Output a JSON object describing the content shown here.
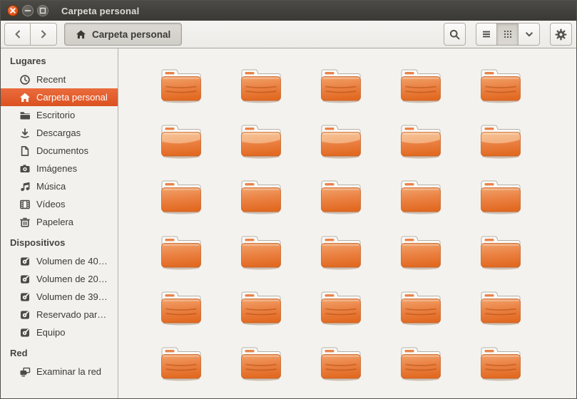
{
  "window": {
    "title": "Carpeta personal",
    "controls": [
      {
        "icon": "close"
      },
      {
        "icon": "minimize"
      },
      {
        "icon": "maximize"
      }
    ]
  },
  "toolbar": {
    "back_icon": "chevron-left",
    "forward_icon": "chevron-right",
    "path_button": {
      "icon": "home",
      "label": "Carpeta personal"
    },
    "search_icon": "search",
    "view_switcher": {
      "options": [
        {
          "name": "list",
          "icon": "list"
        },
        {
          "name": "grid",
          "icon": "grid"
        },
        {
          "name": "options",
          "icon": "chevron-down"
        }
      ],
      "active": "grid"
    },
    "settings_icon": "gear"
  },
  "sidebar": {
    "sections": [
      {
        "title": "Lugares",
        "items": [
          {
            "label": "Recent",
            "icon": "clock",
            "selected": false
          },
          {
            "label": "Carpeta personal",
            "icon": "home",
            "selected": true
          },
          {
            "label": "Escritorio",
            "icon": "desktop-folder",
            "selected": false
          },
          {
            "label": "Descargas",
            "icon": "download",
            "selected": false
          },
          {
            "label": "Documentos",
            "icon": "document",
            "selected": false
          },
          {
            "label": "Imágenes",
            "icon": "camera",
            "selected": false
          },
          {
            "label": "Música",
            "icon": "music",
            "selected": false
          },
          {
            "label": "Vídeos",
            "icon": "film",
            "selected": false
          },
          {
            "label": "Papelera",
            "icon": "trash",
            "selected": false
          }
        ]
      },
      {
        "title": "Dispositivos",
        "items": [
          {
            "label": "Volumen de 40…",
            "icon": "drive",
            "selected": false
          },
          {
            "label": "Volumen de 20…",
            "icon": "drive",
            "selected": false
          },
          {
            "label": "Volumen de 39…",
            "icon": "drive",
            "selected": false
          },
          {
            "label": "Reservado par…",
            "icon": "drive",
            "selected": false
          },
          {
            "label": "Equipo",
            "icon": "drive",
            "selected": false
          }
        ]
      },
      {
        "title": "Red",
        "items": [
          {
            "label": "Examinar la red",
            "icon": "network",
            "selected": false
          }
        ]
      }
    ]
  },
  "content": {
    "view": "icon-grid",
    "columns": 5,
    "rows": 6,
    "items_count": 30,
    "item_icon": "folder",
    "item_labels_visible": false,
    "row_variants": [
      "lines",
      "glossy",
      "plain",
      "plain",
      "lines",
      "lines"
    ]
  },
  "colors": {
    "titlebar": "#3a3935",
    "accent_selection": "#dc5120",
    "close_button": "#e05415",
    "folder_top": "#f1a26b",
    "folder_bottom": "#e26a22",
    "sidebar_bg": "#f2f1ed",
    "content_bg": "#f3f2ee"
  }
}
